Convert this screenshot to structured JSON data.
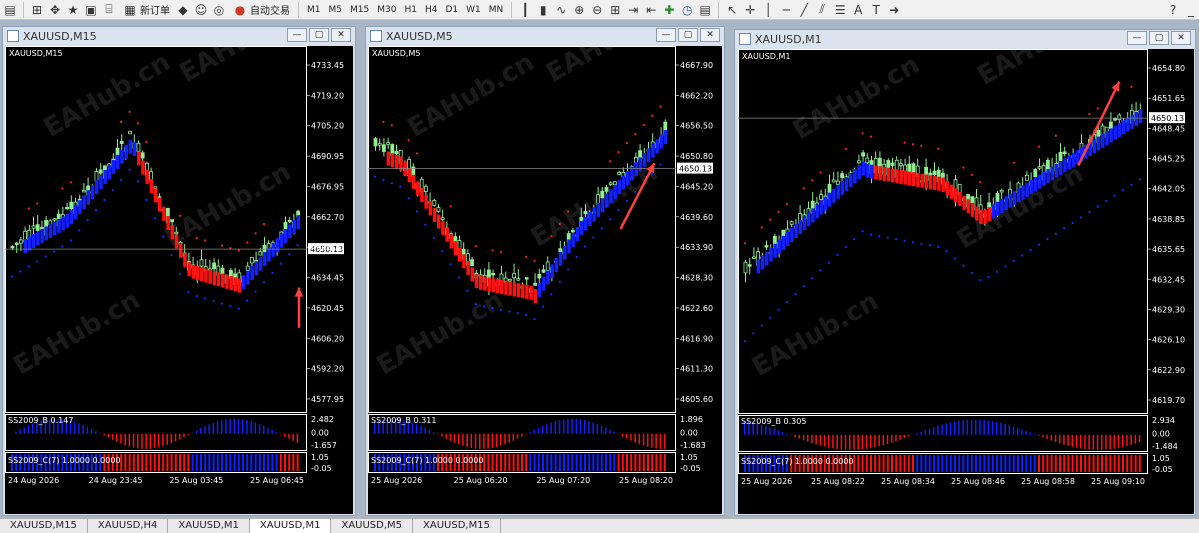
{
  "toolbar": {
    "new_order": "新订单",
    "auto_trade": "自动交易",
    "timeframes": [
      "M1",
      "M5",
      "M15",
      "M30",
      "H1",
      "H4",
      "D1",
      "W1",
      "MN"
    ]
  },
  "watermark": "EAHub.cn",
  "windows": [
    {
      "title": "XAUUSD,M15",
      "chart_label": "XAUUSD,M15",
      "price_labels": [
        "4733.45",
        "4719.20",
        "4705.20",
        "4690.95",
        "4676.95",
        "4662.70",
        "4648.70",
        "4634.45",
        "4620.45",
        "4606.20",
        "4592.20",
        "4577.95"
      ],
      "current_price": "4650.13",
      "ind1_label": "SS2009_B 0.147",
      "ind1_scale": [
        "2.482",
        "0.00",
        "-1.657"
      ],
      "ind2_label": "SS2009_C(7) 1.0000 0.0000",
      "ind2_scale": [
        "1.05",
        "-0.05"
      ],
      "time_labels": [
        "24 Aug 2026",
        "24 Aug 23:45",
        "25 Aug 03:45",
        "25 Aug 06:45"
      ]
    },
    {
      "title": "XAUUSD,M5",
      "chart_label": "XAUUSD,M5",
      "price_labels": [
        "4667.90",
        "4662.20",
        "4656.50",
        "4650.80",
        "4645.20",
        "4639.60",
        "4633.90",
        "4628.30",
        "4622.60",
        "4616.90",
        "4611.30",
        "4605.60"
      ],
      "current_price": "4650.13",
      "ind1_label": "SS2009_B 0.311",
      "ind1_scale": [
        "1.896",
        "0.00",
        "-1.683"
      ],
      "ind2_label": "SS2009_C(7) 1.0000 0.0000",
      "ind2_scale": [
        "1.05",
        "-0.05"
      ],
      "time_labels": [
        "25 Aug 2026",
        "25 Aug 06:20",
        "25 Aug 07:20",
        "25 Aug 08:20"
      ]
    },
    {
      "title": "XAUUSD,M1",
      "chart_label": "XAUUSD,M1",
      "price_labels": [
        "4654.80",
        "4651.65",
        "4648.45",
        "4645.25",
        "4642.05",
        "4638.85",
        "4635.65",
        "4632.45",
        "4629.30",
        "4626.10",
        "4622.90",
        "4619.70"
      ],
      "current_price": "4650.13",
      "ind1_label": "SS2009_B 0.305",
      "ind1_scale": [
        "2.934",
        "0.00",
        "-1.484"
      ],
      "ind2_label": "SS2009_C(7) 1.0000 0.0000",
      "ind2_scale": [
        "1.05",
        "-0.05"
      ],
      "time_labels": [
        "25 Aug 2026",
        "25 Aug 08:22",
        "25 Aug 08:34",
        "25 Aug 08:46",
        "25 Aug 08:58",
        "25 Aug 09:10"
      ]
    }
  ],
  "tabs": [
    "XAUUSD,M15",
    "XAUUSD,H4",
    "XAUUSD,M1",
    "XAUUSD,M1",
    "XAUUSD,M5",
    "XAUUSD,M15"
  ],
  "active_tab_index": 3,
  "colors": {
    "bull_candle": "#90ee90",
    "bear_candle": "#ff2020",
    "indicator_blue": "#0000ff",
    "indicator_red": "#ff0000",
    "arrow": "#ff4040"
  }
}
